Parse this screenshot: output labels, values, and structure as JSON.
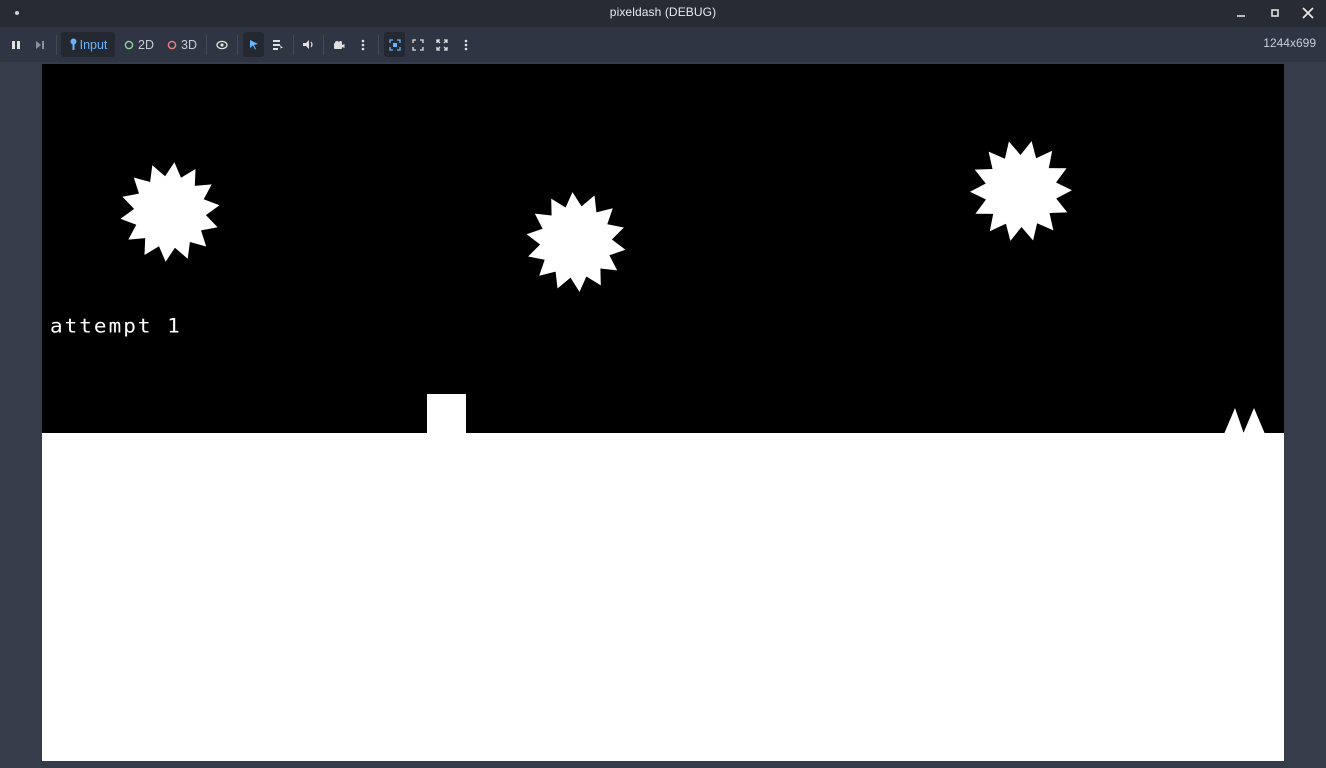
{
  "window": {
    "title": "pixeldash (DEBUG)",
    "controls": [
      "minimize-icon",
      "maximize-icon",
      "close-icon"
    ]
  },
  "toolbar": {
    "pause_icon": "pause-icon",
    "next_frame_icon": "next-frame-icon",
    "input_label": "Input",
    "mode_2d_label": "2D",
    "mode_3d_label": "3D",
    "visibility_icon": "eye-icon",
    "select_icon": "arrow-select-icon",
    "list_icon": "list-select-icon",
    "audio_icon": "speaker-icon",
    "camera_icon": "camera-icon",
    "more_icon": "kebab-menu-icon",
    "embed_icon": "embed-window-icon",
    "fit_icon": "fit-window-icon",
    "fullscreen_icon": "fullscreen-icon",
    "more_icon_2": "kebab-menu-icon",
    "resolution": "1244x699",
    "colors": {
      "accent": "#69b4ff",
      "mode_2d": "#8ed39b",
      "mode_3d": "#f08080"
    }
  },
  "game": {
    "attempt_text": "attempt 1",
    "background": "#000000",
    "foreground": "#ffffff",
    "objects": [
      "spiked-sun-left",
      "spiked-sun-middle",
      "spiked-sun-right",
      "player-square",
      "ground",
      "spike-pair"
    ]
  }
}
